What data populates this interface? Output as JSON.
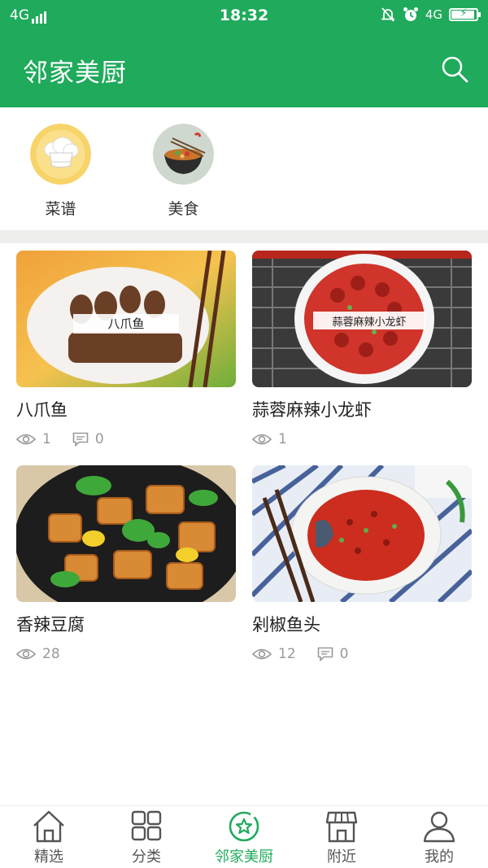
{
  "status_bar": {
    "network_left": "4G",
    "time": "18:32",
    "network_right": "4G"
  },
  "app_bar": {
    "title": "邻家美厨",
    "search_icon": "search-icon"
  },
  "categories": [
    {
      "label": "菜谱",
      "icon": "chef-hat-icon"
    },
    {
      "label": "美食",
      "icon": "noodle-bowl-icon"
    }
  ],
  "recipes": [
    {
      "overlay": "八爪鱼",
      "name": "八爪鱼",
      "views": "1",
      "comments": "0"
    },
    {
      "overlay": "蒜蓉麻辣小龙虾",
      "name": "蒜蓉麻辣小龙虾",
      "views": "1"
    },
    {
      "name": "香辣豆腐",
      "views": "28"
    },
    {
      "name": "剁椒鱼头",
      "views": "12",
      "comments": "0"
    }
  ],
  "tabs": [
    {
      "label": "精选",
      "icon": "home-icon",
      "active": false
    },
    {
      "label": "分类",
      "icon": "grid-icon",
      "active": false
    },
    {
      "label": "邻家美厨",
      "icon": "star-circle-icon",
      "active": true
    },
    {
      "label": "附近",
      "icon": "store-icon",
      "active": false
    },
    {
      "label": "我的",
      "icon": "person-icon",
      "active": false
    }
  ],
  "colors": {
    "brand": "#1faa5c",
    "muted": "#999999",
    "divider": "#eeeeec"
  }
}
